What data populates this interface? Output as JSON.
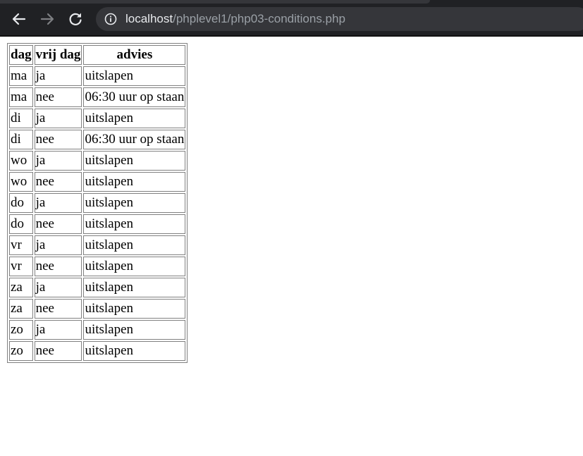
{
  "browser": {
    "url_host": "localhost",
    "url_path": "/phplevel1/php03-conditions.php",
    "icons": {
      "back": "arrow-left-icon",
      "forward": "arrow-right-icon",
      "reload": "reload-icon",
      "site_info": "info-icon"
    },
    "colors": {
      "toolbar": "#202124",
      "omnibox": "#35363a",
      "host_text": "#e8eaed",
      "path_text": "#9aa0a6"
    }
  },
  "table": {
    "headers": [
      "dag",
      "vrij dag",
      "advies"
    ],
    "rows": [
      [
        "ma",
        "ja",
        "uitslapen"
      ],
      [
        "ma",
        "nee",
        "06:30 uur op staan"
      ],
      [
        "di",
        "ja",
        "uitslapen"
      ],
      [
        "di",
        "nee",
        "06:30 uur op staan"
      ],
      [
        "wo",
        "ja",
        "uitslapen"
      ],
      [
        "wo",
        "nee",
        "uitslapen"
      ],
      [
        "do",
        "ja",
        "uitslapen"
      ],
      [
        "do",
        "nee",
        "uitslapen"
      ],
      [
        "vr",
        "ja",
        "uitslapen"
      ],
      [
        "vr",
        "nee",
        "uitslapen"
      ],
      [
        "za",
        "ja",
        "uitslapen"
      ],
      [
        "za",
        "nee",
        "uitslapen"
      ],
      [
        "zo",
        "ja",
        "uitslapen"
      ],
      [
        "zo",
        "nee",
        "uitslapen"
      ]
    ]
  }
}
